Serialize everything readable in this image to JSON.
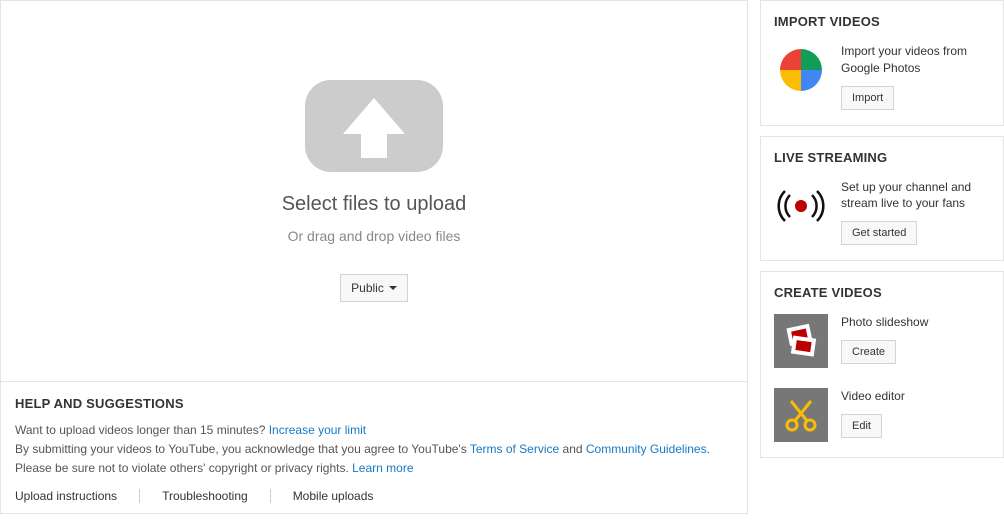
{
  "upload": {
    "title": "Select files to upload",
    "subtitle": "Or drag and drop video files",
    "privacy_label": "Public"
  },
  "help": {
    "heading": "HELP AND SUGGESTIONS",
    "line1_a": "Want to upload videos longer than 15 minutes? ",
    "line1_link": "Increase your limit",
    "line2_a": "By submitting your videos to YouTube, you acknowledge that you agree to YouTube's ",
    "line2_tos": "Terms of Service",
    "line2_and": " and ",
    "line2_cg": "Community Guidelines",
    "line2_end": ".",
    "line3_a": "Please be sure not to violate others' copyright or privacy rights. ",
    "line3_link": "Learn more",
    "links": {
      "a": "Upload instructions",
      "b": "Troubleshooting",
      "c": "Mobile uploads"
    }
  },
  "sidebar": {
    "import": {
      "heading": "IMPORT VIDEOS",
      "desc": "Import your videos from Google Photos",
      "button": "Import"
    },
    "live": {
      "heading": "LIVE STREAMING",
      "desc": "Set up your channel and stream live to your fans",
      "button": "Get started"
    },
    "create": {
      "heading": "CREATE VIDEOS",
      "slideshow": {
        "title": "Photo slideshow",
        "button": "Create"
      },
      "editor": {
        "title": "Video editor",
        "button": "Edit"
      }
    }
  }
}
